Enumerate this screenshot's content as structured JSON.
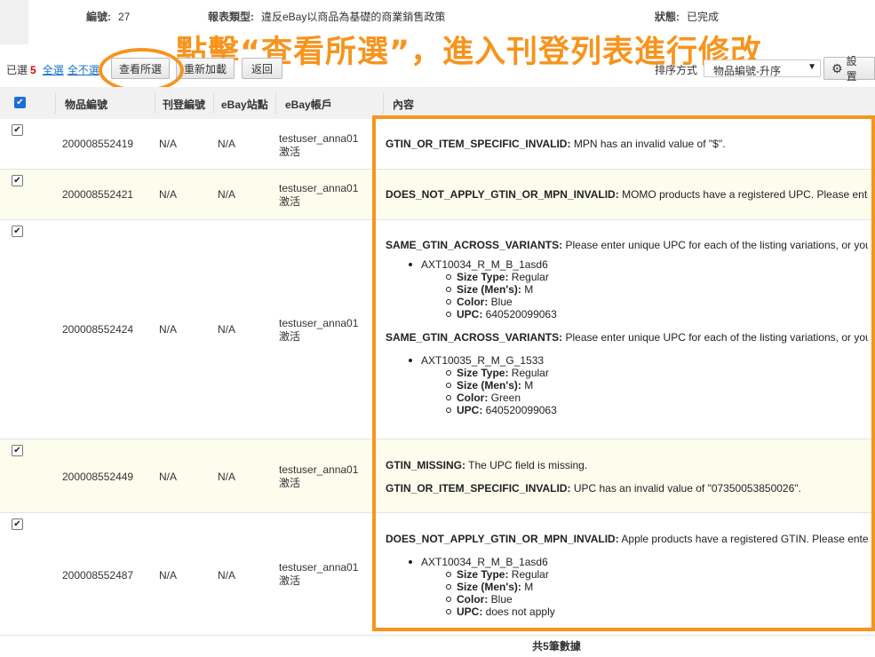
{
  "header": {
    "id_label": "編號:",
    "id_value": "27",
    "report_type_label": "報表類型:",
    "report_type_value": "違反eBay以商品為基礎的商業銷售政策",
    "status_label": "狀態:",
    "status_value": "已完成"
  },
  "annotation": {
    "headline": "點擊“查看所選”，進入刊登列表進行修改",
    "accent_color": "#f7941d"
  },
  "toolbar": {
    "selected_label": "已選",
    "selected_count": "5",
    "select_all": "全選",
    "select_none": "全不選",
    "view_selected": "查看所選",
    "reload": "重新加載",
    "back": "返回",
    "sort_label": "排序方式",
    "sort_value": "物品編號-升序",
    "settings": "設置",
    "settings_icon": "gear-icon"
  },
  "columns": [
    "物品編號",
    "刊登編號",
    "eBay站點",
    "eBay帳戶",
    "內容"
  ],
  "rows": [
    {
      "item_no": "200008552419",
      "listing_no": "N/A",
      "site": "N/A",
      "account": "testuser_anna01",
      "account_status": "激活",
      "blocks": [
        {
          "code": "GTIN_OR_ITEM_SPECIFIC_INVALID:",
          "msg": " MPN has an invalid value of \"$\"."
        }
      ]
    },
    {
      "item_no": "200008552421",
      "listing_no": "N/A",
      "site": "N/A",
      "account": "testuser_anna01",
      "account_status": "激活",
      "blocks": [
        {
          "code": "DOES_NOT_APPLY_GTIN_OR_MPN_INVALID:",
          "msg": " MOMO products have a registered UPC. Please enter"
        }
      ]
    },
    {
      "item_no": "200008552424",
      "listing_no": "N/A",
      "site": "N/A",
      "account": "testuser_anna01",
      "account_status": "激活",
      "blocks": [
        {
          "code": "SAME_GTIN_ACROSS_VARIANTS:",
          "msg": " Please enter unique UPC for each of the listing variations, or you",
          "sku": "AXT10034_R_M_B_1asd6",
          "attrs": [
            [
              "Size Type:",
              " Regular"
            ],
            [
              "Size (Men's):",
              " M"
            ],
            [
              "Color:",
              " Blue"
            ],
            [
              "UPC:",
              " 640520099063"
            ]
          ]
        },
        {
          "code": "SAME_GTIN_ACROSS_VARIANTS:",
          "msg": " Please enter unique UPC for each of the listing variations, or you",
          "sku": "AXT10035_R_M_G_1533",
          "attrs": [
            [
              "Size Type:",
              " Regular"
            ],
            [
              "Size (Men's):",
              " M"
            ],
            [
              "Color:",
              " Green"
            ],
            [
              "UPC:",
              " 640520099063"
            ]
          ]
        }
      ]
    },
    {
      "item_no": "200008552449",
      "listing_no": "N/A",
      "site": "N/A",
      "account": "testuser_anna01",
      "account_status": "激活",
      "blocks": [
        {
          "code": "GTIN_MISSING:",
          "msg": " The UPC field is missing."
        },
        {
          "code": "GTIN_OR_ITEM_SPECIFIC_INVALID:",
          "msg": " UPC has an invalid value of \"07350053850026\"."
        }
      ]
    },
    {
      "item_no": "200008552487",
      "listing_no": "N/A",
      "site": "N/A",
      "account": "testuser_anna01",
      "account_status": "激活",
      "blocks": [
        {
          "code": "DOES_NOT_APPLY_GTIN_OR_MPN_INVALID:",
          "msg": " Apple products have a registered GTIN. Please enter",
          "sku": "AXT10034_R_M_B_1asd6",
          "attrs": [
            [
              "Size Type:",
              " Regular"
            ],
            [
              "Size (Men's):",
              " M"
            ],
            [
              "Color:",
              " Blue"
            ],
            [
              "UPC:",
              " does not apply"
            ]
          ]
        }
      ]
    }
  ],
  "footer": "共5筆數據"
}
